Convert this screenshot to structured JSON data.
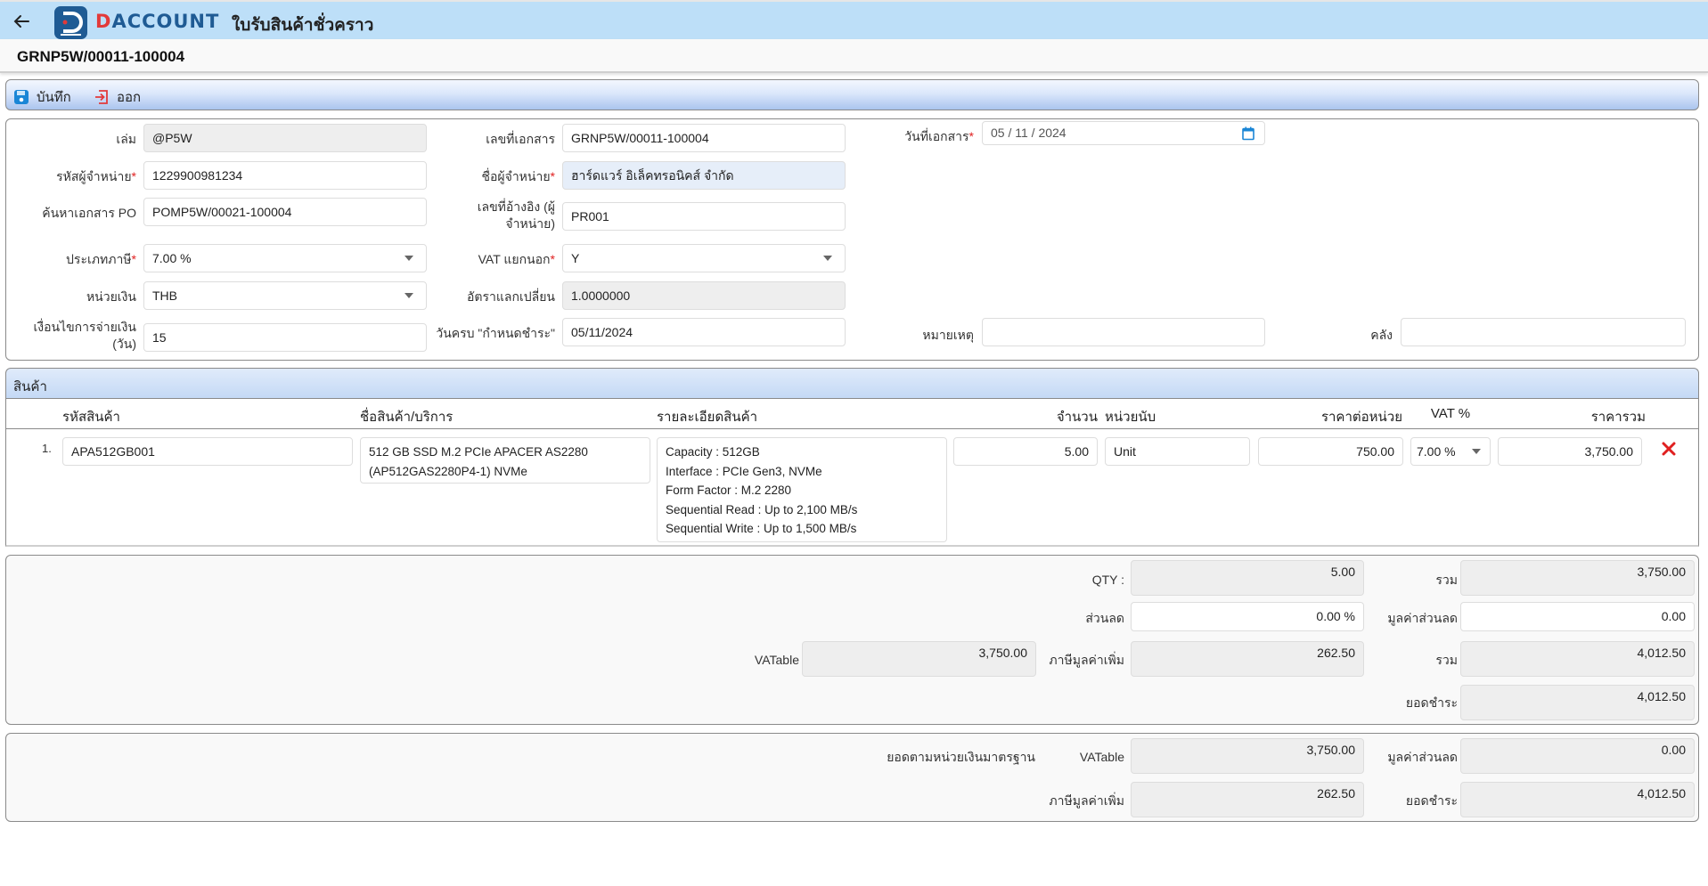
{
  "header": {
    "back_icon": "arrow-left-icon",
    "logo_left": "D",
    "logo_rest": "ACCOUNT",
    "title": "ใบรับสินค้าชั่วคราว",
    "document_number": "GRNP5W/00011-100004"
  },
  "toolbar": {
    "save_label": "บันทึก",
    "save_icon": "floppy-disk-icon",
    "exit_label": "ออก",
    "exit_icon": "exit-icon"
  },
  "form": {
    "book": {
      "label": "เล่ม",
      "value": "@P5W"
    },
    "doc_no": {
      "label": "เลขที่เอกสาร",
      "value": "GRNP5W/00011-100004"
    },
    "doc_date": {
      "label": "วันที่เอกสาร",
      "value": "05 / 11 /  2024"
    },
    "vendor_code": {
      "label": "รหัสผู้จำหน่าย",
      "value": "1229900981234"
    },
    "vendor_name": {
      "label": "ชื่อผู้จำหน่าย",
      "value": "ฮาร์ดแวร์ อิเล็คทรอนิคส์ จำกัด"
    },
    "po_search": {
      "label": "ค้นหาเอกสาร PO",
      "value": "POMP5W/00021-100004"
    },
    "ref_no": {
      "label_line1": "เลขที่อ้างอิง (ผู้",
      "label_line2": "จำหน่าย)",
      "value": "PR001"
    },
    "tax_type": {
      "label": "ประเภทภาษี",
      "value": "7.00 %"
    },
    "vat_separate": {
      "label": "VAT แยกนอก",
      "value": "Y"
    },
    "currency": {
      "label": "หน่วยเงิน",
      "value": "THB"
    },
    "exchange_rate": {
      "label": "อัตราแลกเปลี่ยน",
      "value": "1.0000000"
    },
    "payment_terms": {
      "label_line1": "เงื่อนไขการจ่ายเงิน",
      "label_line2": "(วัน)",
      "value": "15"
    },
    "due_date": {
      "label": "วันครบ \"กำหนดชำระ\"",
      "value": "05/11/2024"
    },
    "remark": {
      "label": "หมายเหตุ",
      "value": ""
    },
    "warehouse": {
      "label": "คลัง",
      "value": ""
    },
    "required_mark": "*"
  },
  "products": {
    "section_title": "สินค้า",
    "columns": {
      "code": "รหัสสินค้า",
      "name": "ชื่อสินค้า/บริการ",
      "detail": "รายละเอียดสินค้า",
      "qty": "จำนวน",
      "unit": "หน่วยนับ",
      "unit_price": "ราคาต่อหน่วย",
      "vat": "VAT %",
      "total": "ราคารวม"
    },
    "rows": [
      {
        "index": "1.",
        "code": "APA512GB001",
        "name_line1": "512 GB SSD M.2 PCIe APACER AS2280",
        "name_line2": "(AP512GAS2280P4-1) NVMe",
        "detail": [
          "Capacity : 512GB",
          "Interface : PCIe Gen3, NVMe",
          "Form Factor : M.2 2280",
          "Sequential Read : Up to 2,100 MB/s",
          "Sequential Write : Up to 1,500 MB/s"
        ],
        "qty": "5.00",
        "unit": "Unit",
        "unit_price": "750.00",
        "vat": "7.00 %",
        "total": "3,750.00",
        "delete_icon": "close-x-icon"
      }
    ]
  },
  "summary": {
    "qty_label": "QTY :",
    "qty": "5.00",
    "subtotal_label": "รวม",
    "subtotal": "3,750.00",
    "discount_label": "ส่วนลด",
    "discount_pct": "0.00 %",
    "discount_value_label": "มูลค่าส่วนลด",
    "discount_value": "0.00",
    "vatable_label": "VATable",
    "vatable": "3,750.00",
    "vat_label": "ภาษีมูลค่าเพิ่ม",
    "vat": "262.50",
    "total_label": "รวม",
    "total": "4,012.50",
    "payable_label": "ยอดชำระ",
    "payable": "4,012.50"
  },
  "base_currency": {
    "title": "ยอดตามหน่วยเงินมาตรฐาน",
    "vatable_label": "VATable",
    "vatable": "3,750.00",
    "discount_value_label": "มูลค่าส่วนลด",
    "discount_value": "0.00",
    "vat_label": "ภาษีมูลค่าเพิ่ม",
    "vat": "262.50",
    "payable_label": "ยอดชำระ",
    "payable": "4,012.50"
  },
  "colors": {
    "header_bg": "#bddff8",
    "brand_blue": "#1f5b94",
    "brand_red": "#e23a3a",
    "required": "#e02020",
    "readonly_bg": "#eeeeee"
  }
}
